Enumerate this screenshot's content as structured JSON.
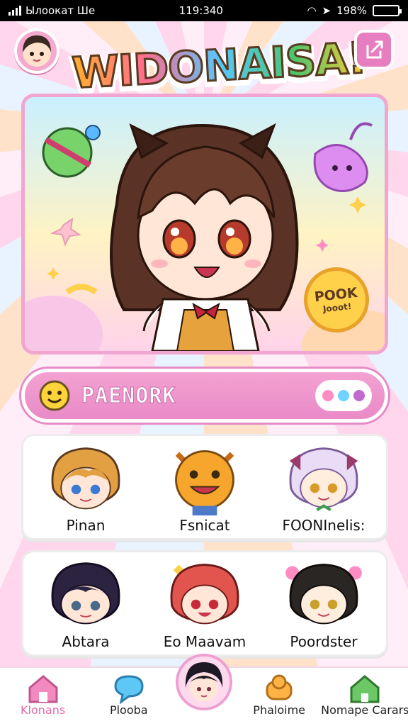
{
  "status_bar": {
    "carrier": "Ылоокат Ше",
    "time": "119:340",
    "battery": "198%"
  },
  "header": {
    "title": "WIDONAISA!"
  },
  "hero": {
    "badge_line1": "POOK",
    "badge_line2": "Jooot!"
  },
  "section": {
    "label": "PAENORK"
  },
  "characters": [
    [
      {
        "name": "Pinan"
      },
      {
        "name": "Fsnicat"
      },
      {
        "name": "FOONInelis:"
      }
    ],
    [
      {
        "name": "Abtara"
      },
      {
        "name": "Eo Maavam"
      },
      {
        "name": "Poordster"
      }
    ]
  ],
  "nav": {
    "items": [
      {
        "label": "Klonans",
        "icon": "home-icon"
      },
      {
        "label": "Plooba",
        "icon": "chat-bubble-icon"
      },
      {
        "label": "Phaloime",
        "icon": "character-icon"
      },
      {
        "label": "Nomape Carars",
        "icon": "house-icon"
      }
    ]
  },
  "colors": {
    "accent_pink": "#e98ac7",
    "accent_purple": "#c06ad0",
    "badge_yellow": "#ffd04a"
  }
}
